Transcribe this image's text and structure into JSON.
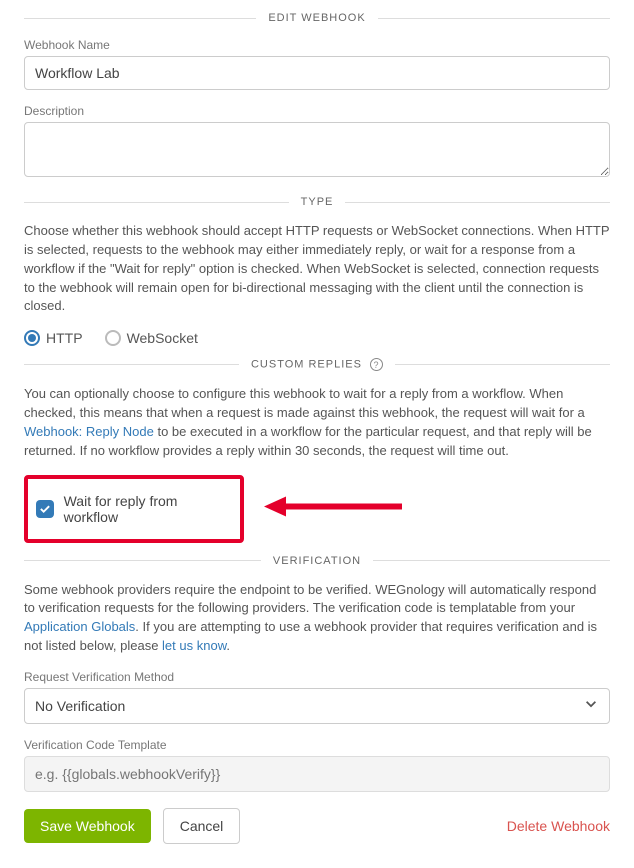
{
  "editWebhook": {
    "title": "EDIT WEBHOOK",
    "nameLabel": "Webhook Name",
    "nameValue": "Workflow Lab",
    "descLabel": "Description",
    "descValue": ""
  },
  "type": {
    "title": "TYPE",
    "description": "Choose whether this webhook should accept HTTP requests or WebSocket connections. When HTTP is selected, requests to the webhook may either immediately reply, or wait for a response from a workflow if the \"Wait for reply\" option is checked. When WebSocket is selected, connection requests to the webhook will remain open for bi-directional messaging with the client until the connection is closed.",
    "options": {
      "http": "HTTP",
      "websocket": "WebSocket"
    },
    "selected": "http"
  },
  "customReplies": {
    "title": "CUSTOM REPLIES",
    "descBefore": "You can optionally choose to configure this webhook to wait for a reply from a workflow. When checked, this means that when a request is made against this webhook, the request will wait for a ",
    "linkText": "Webhook: Reply Node",
    "descAfter": " to be executed in a workflow for the particular request, and that reply will be returned. If no workflow provides a reply within 30 seconds, the request will time out.",
    "checkboxLabel": "Wait for reply from workflow",
    "checked": true
  },
  "verification": {
    "title": "VERIFICATION",
    "descBefore": "Some webhook providers require the endpoint to be verified. WEGnology will automatically respond to verification requests for the following providers. The verification code is templatable from your ",
    "link1": "Application Globals",
    "descMiddle": ". If you are attempting to use a webhook provider that requires verification and is not listed below, please ",
    "link2": "let us know",
    "descAfter": ".",
    "methodLabel": "Request Verification Method",
    "methodValue": "No Verification",
    "templateLabel": "Verification Code Template",
    "templatePlaceholder": "e.g. {{globals.webhookVerify}}"
  },
  "actions": {
    "save": "Save Webhook",
    "cancel": "Cancel",
    "delete": "Delete Webhook"
  }
}
